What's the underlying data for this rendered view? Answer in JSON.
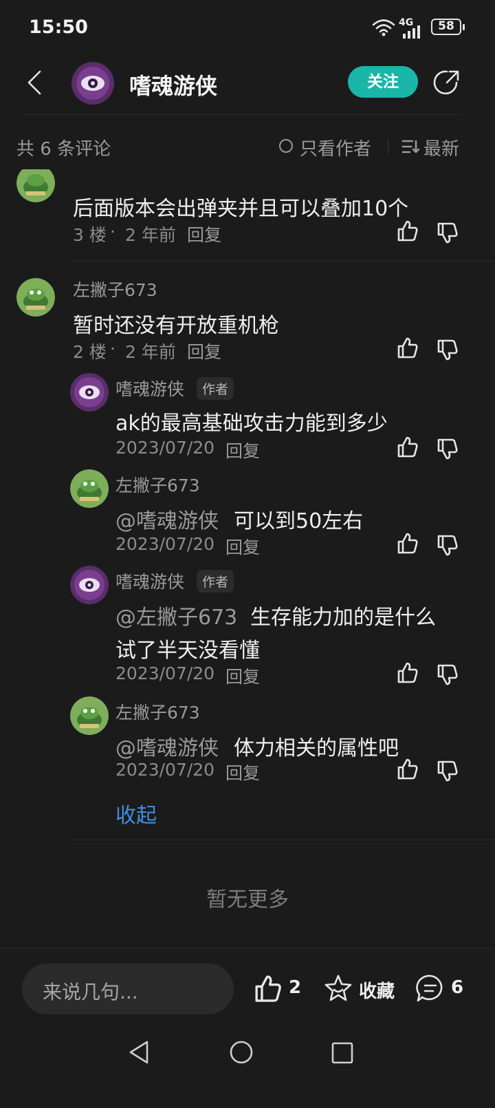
{
  "status_bar": {
    "time": "15:50",
    "network": "4G",
    "battery": "58"
  },
  "header": {
    "title": "嗜魂游侠",
    "follow_label": "关注"
  },
  "toolbar": {
    "count_label": "共 6 条评论",
    "author_only_label": "只看作者",
    "sort_label": "最新"
  },
  "comments": [
    {
      "text": "后面版本会出弹夹并且可以叠加10个",
      "floor": "3 楼",
      "time": "2 年前",
      "reply": "回复"
    },
    {
      "user": "左撇子673",
      "text": "暂时还没有开放重机枪",
      "floor": "2 楼",
      "time": "2 年前",
      "reply": "回复",
      "replies": [
        {
          "user": "嗜魂游侠",
          "tag": "作者",
          "text": "ak的最高基础攻击力能到多少",
          "date": "2023/07/20",
          "reply": "回复"
        },
        {
          "user": "左撇子673",
          "mention": "@嗜魂游侠",
          "text": "可以到50左右",
          "date": "2023/07/20",
          "reply": "回复"
        },
        {
          "user": "嗜魂游侠",
          "tag": "作者",
          "mention": "@左撇子673",
          "text": "生存能力加的是什么",
          "text2": "试了半天没看懂",
          "date": "2023/07/20",
          "reply": "回复"
        },
        {
          "user": "左撇子673",
          "mention": "@嗜魂游侠",
          "text": "体力相关的属性吧",
          "date": "2023/07/20",
          "reply": "回复"
        }
      ],
      "collapse_label": "收起"
    }
  ],
  "end_label": "暂无更多",
  "bottom_bar": {
    "input_placeholder": "来说几句...",
    "like_count": "2",
    "collect_label": "收藏",
    "comment_count": "6"
  },
  "colors": {
    "accent": "#1ab6a8",
    "link": "#3f8fe0",
    "background": "#1b1b1b"
  }
}
